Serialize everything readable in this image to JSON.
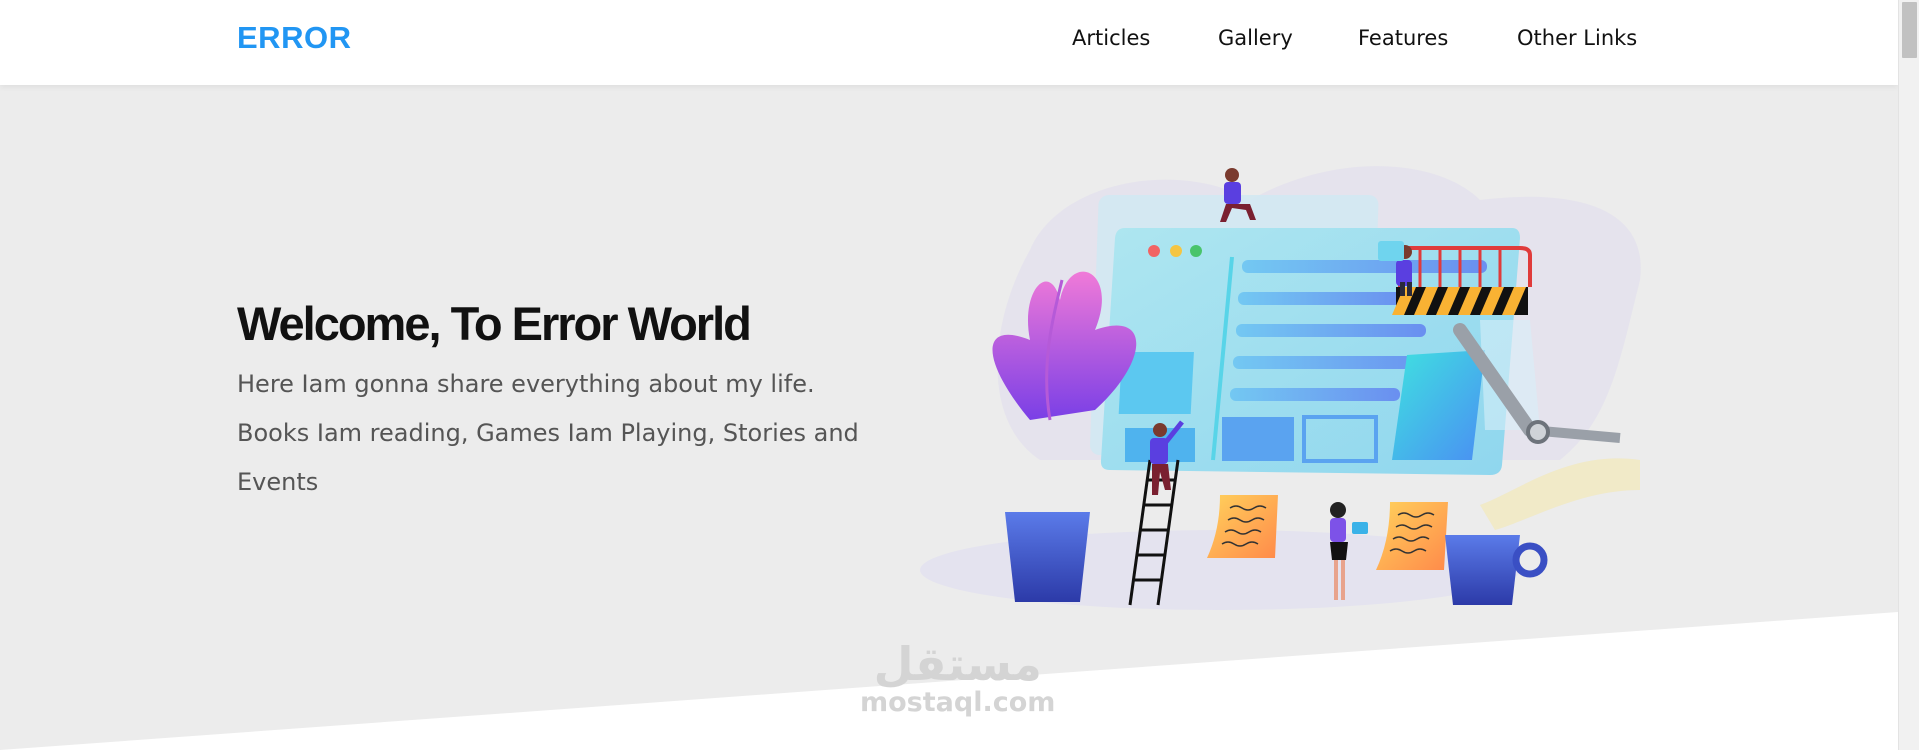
{
  "header": {
    "logo": "ERROR",
    "nav": [
      "Articles",
      "Gallery",
      "Features",
      "Other Links"
    ]
  },
  "hero": {
    "title": "Welcome, To Error World",
    "text": "Here Iam gonna share everything about my life. Books Iam reading, Games Iam Playing, Stories and Events"
  },
  "watermark": {
    "arabic": "مستقل",
    "latin": "mostaql.com"
  },
  "colors": {
    "brand": "#2196f3",
    "background": "#ececec",
    "header_bg": "#ffffff"
  }
}
